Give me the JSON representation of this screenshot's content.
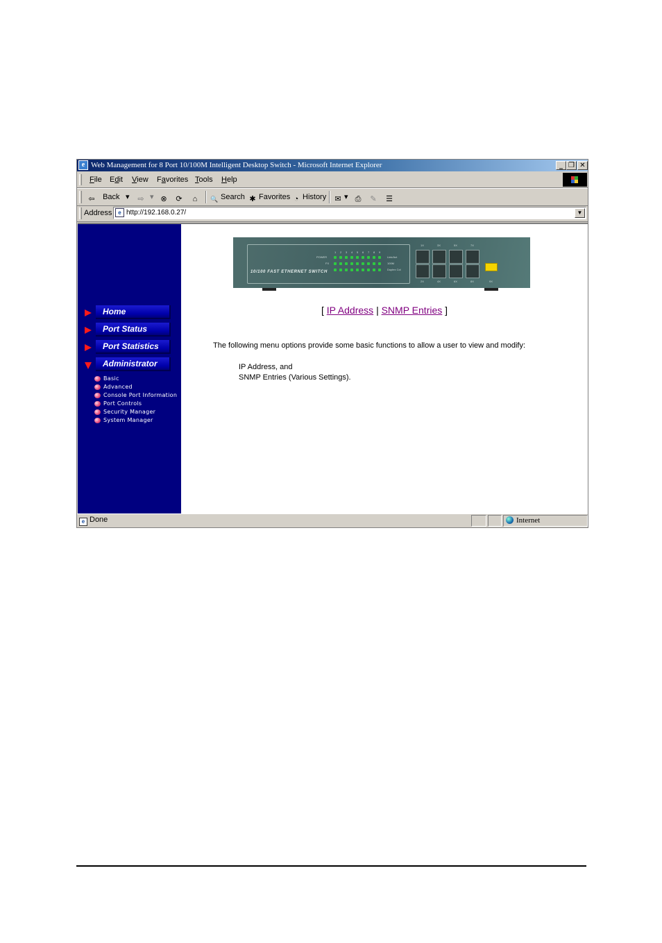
{
  "window": {
    "title": "Web Management for 8 Port 10/100M Intelligent Desktop Switch - Microsoft Internet Explorer",
    "controls": {
      "minimize": "_",
      "restore": "❐",
      "close": "✕"
    }
  },
  "menubar": {
    "items": [
      {
        "label": "File",
        "accel": "F"
      },
      {
        "label": "Edit",
        "accel": "d"
      },
      {
        "label": "View",
        "accel": "V"
      },
      {
        "label": "Favorites",
        "accel": "a"
      },
      {
        "label": "Tools",
        "accel": "T"
      },
      {
        "label": "Help",
        "accel": "H"
      }
    ]
  },
  "toolbar": {
    "back": "Back",
    "search": "Search",
    "favorites": "Favorites",
    "history": "History",
    "icons": {
      "back": "⇦",
      "forward": "⇨",
      "dropdown": "▾",
      "stop": "⊗",
      "refresh": "⟳",
      "home": "⌂",
      "search": "🔍",
      "favorites": "✱",
      "history": "◔",
      "mail": "✉",
      "print": "⎙",
      "edit": "✎",
      "discuss": "☰"
    }
  },
  "address": {
    "label": "Address",
    "value": "http://192.168.0.27/",
    "page_icon": "e",
    "dropdown": "▼"
  },
  "sidebar": {
    "nav": [
      {
        "label": "Home",
        "expanded": false
      },
      {
        "label": "Port Status",
        "expanded": false
      },
      {
        "label": "Port Statistics",
        "expanded": false
      },
      {
        "label": "Administrator",
        "expanded": true
      }
    ],
    "sub_items": [
      "Basic",
      "Advanced",
      "Console Port Information",
      "Port Controls",
      "Security Manager",
      "System Manager"
    ]
  },
  "device": {
    "label": "10/100 FAST ETHERNET SWITCH",
    "led_labels": {
      "power": "POWER",
      "fx": "FX",
      "row1": "Link/Act",
      "row2": "100M",
      "row3": "Duplex Col"
    },
    "port_numbers": [
      "1",
      "2",
      "3",
      "4",
      "5",
      "6",
      "7",
      "8",
      "9"
    ],
    "top_port_labels": [
      "1X",
      "3X",
      "5X",
      "7X"
    ],
    "bottom_port_labels": [
      "2X",
      "4X",
      "6X",
      "8X",
      "9X"
    ]
  },
  "content": {
    "bracket_open": "[",
    "separator": "|",
    "bracket_close": "]",
    "links": [
      "IP Address",
      "SNMP Entries"
    ],
    "intro": "The following menu options provide some basic functions to allow a user to view and modify:",
    "list": [
      "IP Address, and",
      "SNMP Entries (Various Settings)."
    ],
    "link_color": "#800080"
  },
  "statusbar": {
    "status": "Done",
    "zone": "Internet"
  },
  "colors": {
    "sidebar_bg": "#000080",
    "nav_arrow": "#ff1a1a",
    "titlebar_start": "#0a246a",
    "chrome": "#d4d0c8"
  }
}
